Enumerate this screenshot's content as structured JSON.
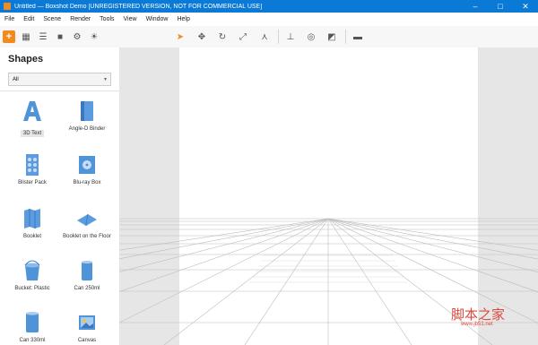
{
  "window": {
    "title": "Untitled — Boxshot Demo [UNREGISTERED VERSION, NOT FOR COMMERCIAL USE]",
    "minimize": "–",
    "maximize": "□",
    "close": "✕"
  },
  "menu": [
    "File",
    "Edit",
    "Scene",
    "Render",
    "Tools",
    "View",
    "Window",
    "Help"
  ],
  "colors": {
    "accent": "#f28a1e",
    "titlebar": "#0a7ad6",
    "shape_blue": "#4f93d8"
  },
  "shapes_panel": {
    "title": "Shapes",
    "filter": "All",
    "items": [
      {
        "label": "3D Text",
        "icon": "3d-text-icon"
      },
      {
        "label": "Angle-D Binder",
        "icon": "binder-icon"
      },
      {
        "label": "Blister Pack",
        "icon": "blister-pack-icon"
      },
      {
        "label": "Blu-ray Box",
        "icon": "bluray-box-icon"
      },
      {
        "label": "Booklet",
        "icon": "booklet-icon"
      },
      {
        "label": "Booklet on the Floor",
        "icon": "booklet-floor-icon"
      },
      {
        "label": "Bucket: Plastic",
        "icon": "bucket-icon"
      },
      {
        "label": "Can 250ml",
        "icon": "can-250-icon"
      },
      {
        "label": "Can 330ml",
        "icon": "can-330-icon"
      },
      {
        "label": "Canvas",
        "icon": "canvas-icon"
      }
    ]
  },
  "watermark": {
    "main": "脚本之家",
    "sub": "www.jb51.net"
  }
}
